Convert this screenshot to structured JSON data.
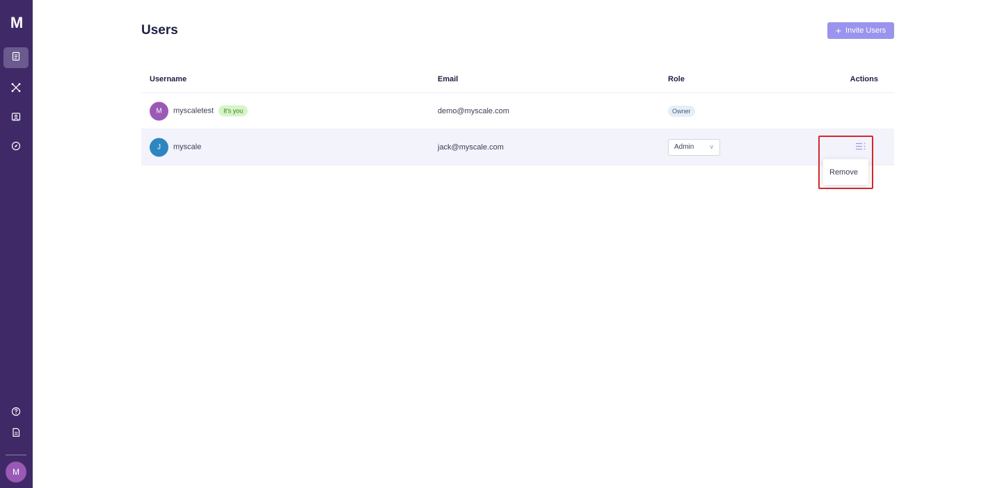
{
  "app": {
    "logo_text": "M"
  },
  "sidebar": {
    "items": [
      {
        "icon": "document-list-icon",
        "active": true
      },
      {
        "icon": "network-icon",
        "active": false
      },
      {
        "icon": "gallery-icon",
        "active": false
      },
      {
        "icon": "compass-icon",
        "active": false
      }
    ],
    "bottom": [
      {
        "icon": "help-icon"
      },
      {
        "icon": "docs-icon"
      }
    ],
    "avatar_initial": "M"
  },
  "header": {
    "title": "Users",
    "invite_button": {
      "icon": "plus-icon",
      "label": "Invite Users"
    }
  },
  "table": {
    "columns": [
      "Username",
      "Email",
      "Role",
      "Actions"
    ],
    "rows": [
      {
        "initial": "M",
        "avatar_color": "#9b59b6",
        "username": "myscaletest",
        "badge": "It's you",
        "email": "demo@myscale.com",
        "role": "Owner"
      },
      {
        "initial": "J",
        "avatar_color": "#2e86c1",
        "username": "myscale",
        "email": "jack@myscale.com",
        "role": "Admin"
      }
    ]
  },
  "actions_menu": {
    "items": [
      "Remove"
    ]
  },
  "colors": {
    "sidebar": "#3f2a67",
    "accent": "#9a94ee",
    "highlight": "#d6262c"
  }
}
